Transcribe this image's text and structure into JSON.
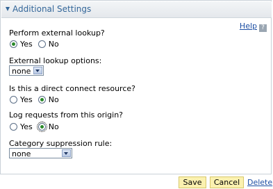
{
  "panel": {
    "title": "Additional Settings",
    "help_label": "Help",
    "help_badge": "?"
  },
  "fields": {
    "external_lookup": {
      "label": "Perform external lookup?",
      "options": [
        "Yes",
        "No"
      ],
      "selected": "Yes"
    },
    "external_lookup_options": {
      "label": "External lookup options:",
      "value": "none"
    },
    "direct_connect": {
      "label": "Is this a direct connect resource?",
      "options": [
        "Yes",
        "No"
      ],
      "selected": "No"
    },
    "log_requests": {
      "label": "Log requests from this origin?",
      "options": [
        "Yes",
        "No"
      ],
      "selected": "No"
    },
    "category_suppression": {
      "label": "Category suppression rule:",
      "value": "none"
    }
  },
  "actions": {
    "save": "Save",
    "cancel": "Cancel",
    "delete": "Delete"
  },
  "colors": {
    "header_text": "#336699",
    "link": "#1c4ea3",
    "button_bg": "#fbf1b0",
    "radio_checked": "#2a8a2a"
  }
}
